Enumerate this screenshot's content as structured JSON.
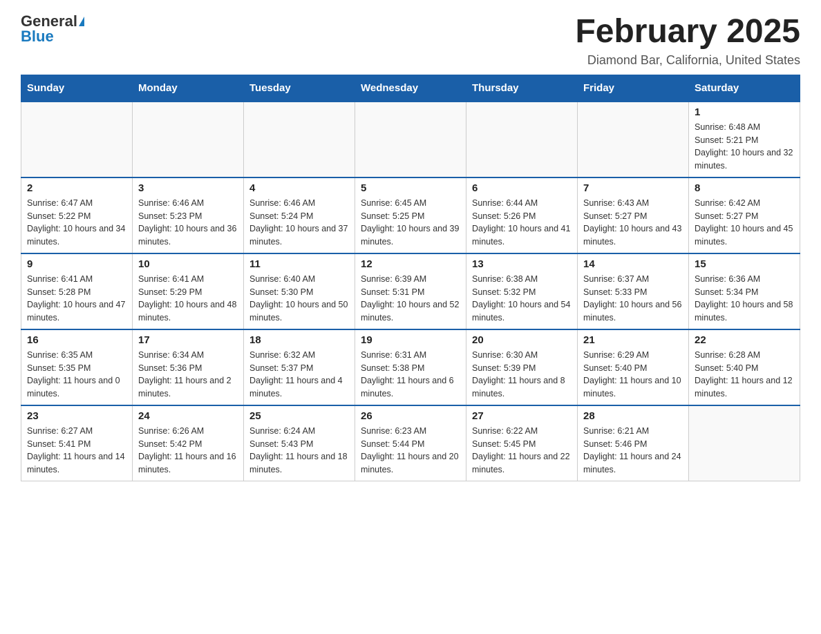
{
  "header": {
    "logo_general": "General",
    "logo_blue": "Blue",
    "month_title": "February 2025",
    "location": "Diamond Bar, California, United States"
  },
  "days_of_week": [
    "Sunday",
    "Monday",
    "Tuesday",
    "Wednesday",
    "Thursday",
    "Friday",
    "Saturday"
  ],
  "weeks": [
    [
      {
        "day": "",
        "info": ""
      },
      {
        "day": "",
        "info": ""
      },
      {
        "day": "",
        "info": ""
      },
      {
        "day": "",
        "info": ""
      },
      {
        "day": "",
        "info": ""
      },
      {
        "day": "",
        "info": ""
      },
      {
        "day": "1",
        "info": "Sunrise: 6:48 AM\nSunset: 5:21 PM\nDaylight: 10 hours and 32 minutes."
      }
    ],
    [
      {
        "day": "2",
        "info": "Sunrise: 6:47 AM\nSunset: 5:22 PM\nDaylight: 10 hours and 34 minutes."
      },
      {
        "day": "3",
        "info": "Sunrise: 6:46 AM\nSunset: 5:23 PM\nDaylight: 10 hours and 36 minutes."
      },
      {
        "day": "4",
        "info": "Sunrise: 6:46 AM\nSunset: 5:24 PM\nDaylight: 10 hours and 37 minutes."
      },
      {
        "day": "5",
        "info": "Sunrise: 6:45 AM\nSunset: 5:25 PM\nDaylight: 10 hours and 39 minutes."
      },
      {
        "day": "6",
        "info": "Sunrise: 6:44 AM\nSunset: 5:26 PM\nDaylight: 10 hours and 41 minutes."
      },
      {
        "day": "7",
        "info": "Sunrise: 6:43 AM\nSunset: 5:27 PM\nDaylight: 10 hours and 43 minutes."
      },
      {
        "day": "8",
        "info": "Sunrise: 6:42 AM\nSunset: 5:27 PM\nDaylight: 10 hours and 45 minutes."
      }
    ],
    [
      {
        "day": "9",
        "info": "Sunrise: 6:41 AM\nSunset: 5:28 PM\nDaylight: 10 hours and 47 minutes."
      },
      {
        "day": "10",
        "info": "Sunrise: 6:41 AM\nSunset: 5:29 PM\nDaylight: 10 hours and 48 minutes."
      },
      {
        "day": "11",
        "info": "Sunrise: 6:40 AM\nSunset: 5:30 PM\nDaylight: 10 hours and 50 minutes."
      },
      {
        "day": "12",
        "info": "Sunrise: 6:39 AM\nSunset: 5:31 PM\nDaylight: 10 hours and 52 minutes."
      },
      {
        "day": "13",
        "info": "Sunrise: 6:38 AM\nSunset: 5:32 PM\nDaylight: 10 hours and 54 minutes."
      },
      {
        "day": "14",
        "info": "Sunrise: 6:37 AM\nSunset: 5:33 PM\nDaylight: 10 hours and 56 minutes."
      },
      {
        "day": "15",
        "info": "Sunrise: 6:36 AM\nSunset: 5:34 PM\nDaylight: 10 hours and 58 minutes."
      }
    ],
    [
      {
        "day": "16",
        "info": "Sunrise: 6:35 AM\nSunset: 5:35 PM\nDaylight: 11 hours and 0 minutes."
      },
      {
        "day": "17",
        "info": "Sunrise: 6:34 AM\nSunset: 5:36 PM\nDaylight: 11 hours and 2 minutes."
      },
      {
        "day": "18",
        "info": "Sunrise: 6:32 AM\nSunset: 5:37 PM\nDaylight: 11 hours and 4 minutes."
      },
      {
        "day": "19",
        "info": "Sunrise: 6:31 AM\nSunset: 5:38 PM\nDaylight: 11 hours and 6 minutes."
      },
      {
        "day": "20",
        "info": "Sunrise: 6:30 AM\nSunset: 5:39 PM\nDaylight: 11 hours and 8 minutes."
      },
      {
        "day": "21",
        "info": "Sunrise: 6:29 AM\nSunset: 5:40 PM\nDaylight: 11 hours and 10 minutes."
      },
      {
        "day": "22",
        "info": "Sunrise: 6:28 AM\nSunset: 5:40 PM\nDaylight: 11 hours and 12 minutes."
      }
    ],
    [
      {
        "day": "23",
        "info": "Sunrise: 6:27 AM\nSunset: 5:41 PM\nDaylight: 11 hours and 14 minutes."
      },
      {
        "day": "24",
        "info": "Sunrise: 6:26 AM\nSunset: 5:42 PM\nDaylight: 11 hours and 16 minutes."
      },
      {
        "day": "25",
        "info": "Sunrise: 6:24 AM\nSunset: 5:43 PM\nDaylight: 11 hours and 18 minutes."
      },
      {
        "day": "26",
        "info": "Sunrise: 6:23 AM\nSunset: 5:44 PM\nDaylight: 11 hours and 20 minutes."
      },
      {
        "day": "27",
        "info": "Sunrise: 6:22 AM\nSunset: 5:45 PM\nDaylight: 11 hours and 22 minutes."
      },
      {
        "day": "28",
        "info": "Sunrise: 6:21 AM\nSunset: 5:46 PM\nDaylight: 11 hours and 24 minutes."
      },
      {
        "day": "",
        "info": ""
      }
    ]
  ]
}
